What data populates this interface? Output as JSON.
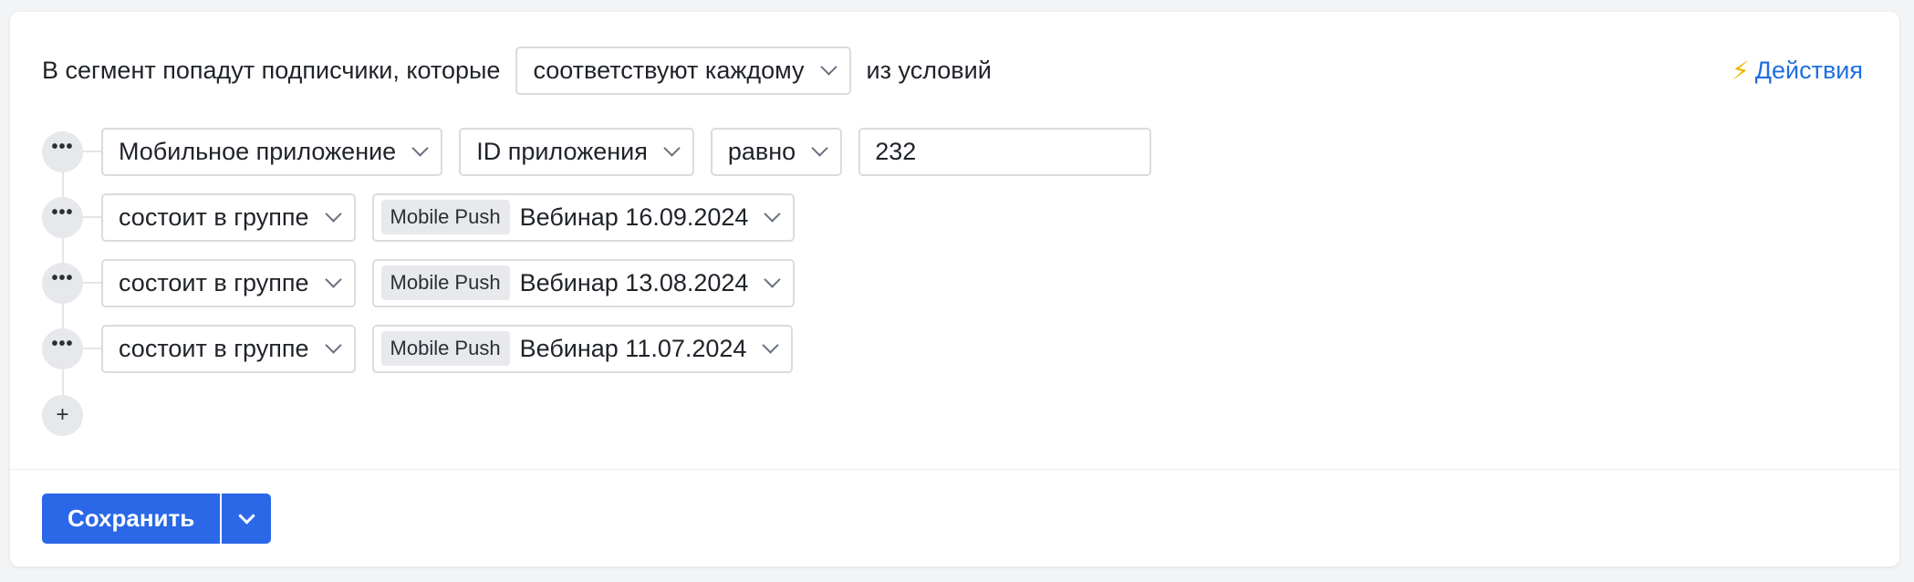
{
  "header": {
    "prefix": "В сегмент попадут подписчики, которые",
    "match_mode": "соответствуют каждому",
    "suffix": "из условий",
    "actions_icon": "⚡",
    "actions_label": "Действия"
  },
  "conditions": [
    {
      "type": "app",
      "source": "Мобильное приложение",
      "field": "ID приложения",
      "operator": "равно",
      "value": "232"
    },
    {
      "type": "group",
      "operator": "состоит в группе",
      "group_tag": "Mobile Push",
      "group_name": "Вебинар 16.09.2024"
    },
    {
      "type": "group",
      "operator": "состоит в группе",
      "group_tag": "Mobile Push",
      "group_name": "Вебинар 13.08.2024"
    },
    {
      "type": "group",
      "operator": "состоит в группе",
      "group_tag": "Mobile Push",
      "group_name": "Вебинар 11.07.2024"
    }
  ],
  "row_menu_icon": "•••",
  "add_button": "+",
  "footer": {
    "save_label": "Сохранить"
  },
  "colors": {
    "primary": "#2a68e8",
    "link": "#1f6fe0",
    "bolt": "#f0b400"
  }
}
